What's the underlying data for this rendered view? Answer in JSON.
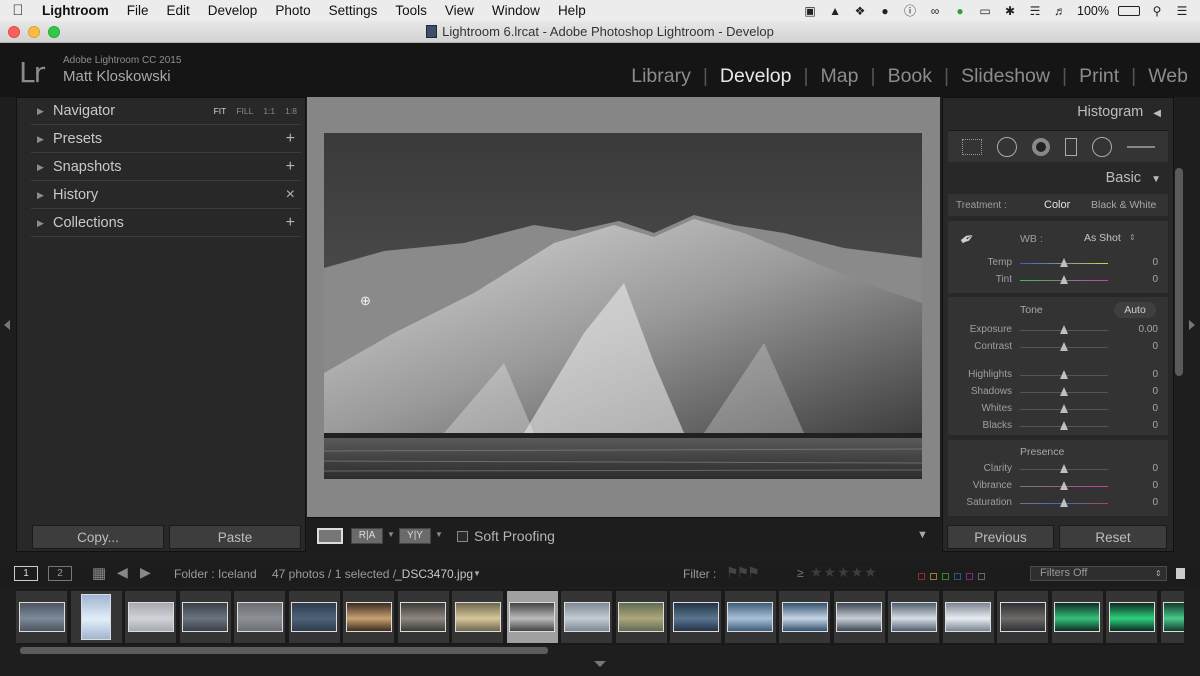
{
  "menubar": {
    "app_name": "Lightroom",
    "items": [
      "File",
      "Edit",
      "Develop",
      "Photo",
      "Settings",
      "Tools",
      "View",
      "Window",
      "Help"
    ],
    "battery": "100%"
  },
  "window": {
    "title": "Lightroom 6.lrcat - Adobe Photoshop Lightroom - Develop"
  },
  "identity_plate": {
    "product": "Adobe Lightroom CC 2015",
    "user": "Matt Kloskowski"
  },
  "modules": {
    "items": [
      "Library",
      "Develop",
      "Map",
      "Book",
      "Slideshow",
      "Print",
      "Web"
    ],
    "active": "Develop"
  },
  "left_panel": {
    "navigator": {
      "label": "Navigator",
      "zoom_options": [
        "FIT",
        "FILL",
        "1:1",
        "1:8"
      ]
    },
    "presets": "Presets",
    "snapshots": "Snapshots",
    "history": "History",
    "collections": "Collections",
    "copy_button": "Copy...",
    "paste_button": "Paste"
  },
  "toolbar": {
    "before_after_1": "R|A",
    "before_after_2": "Y|Y",
    "soft_proofing": "Soft Proofing"
  },
  "right_panel": {
    "histogram": "Histogram",
    "basic": "Basic",
    "treatment_label": "Treatment :",
    "treatment_color": "Color",
    "treatment_bw": "Black & White",
    "wb_label": "WB :",
    "wb_value": "As Shot",
    "tone_label": "Tone",
    "auto_label": "Auto",
    "presence_label": "Presence",
    "sliders": {
      "temp": {
        "label": "Temp",
        "value": "0"
      },
      "tint": {
        "label": "Tint",
        "value": "0"
      },
      "exposure": {
        "label": "Exposure",
        "value": "0.00"
      },
      "contrast": {
        "label": "Contrast",
        "value": "0"
      },
      "highlights": {
        "label": "Highlights",
        "value": "0"
      },
      "shadows": {
        "label": "Shadows",
        "value": "0"
      },
      "whites": {
        "label": "Whites",
        "value": "0"
      },
      "blacks": {
        "label": "Blacks",
        "value": "0"
      },
      "clarity": {
        "label": "Clarity",
        "value": "0"
      },
      "vibrance": {
        "label": "Vibrance",
        "value": "0"
      },
      "saturation": {
        "label": "Saturation",
        "value": "0"
      }
    },
    "previous_button": "Previous",
    "reset_button": "Reset"
  },
  "filmstrip": {
    "monitor_1": "1",
    "monitor_2": "2",
    "folder": "Folder : Iceland",
    "count": "47 photos / 1 selected /",
    "filename": "_DSC3470.jpg",
    "filter_label": "Filter :",
    "filters_value": "Filters Off",
    "selected_index": 9,
    "thumbs": [
      {
        "bg": "#4c5560",
        "accent": "#7d8a99"
      },
      {
        "bg": "#9fb5d1",
        "accent": "#e4eef8"
      },
      {
        "bg": "#a6a9ad",
        "accent": "#d0d3d7"
      },
      {
        "bg": "#3a4047",
        "accent": "#6a7480"
      },
      {
        "bg": "#6b6e72",
        "accent": "#8c9096"
      },
      {
        "bg": "#2e3b4a",
        "accent": "#4f637a"
      },
      {
        "bg": "#3a2d20",
        "accent": "#c9a071"
      },
      {
        "bg": "#3b3a38",
        "accent": "#8f8880"
      },
      {
        "bg": "#6d6650",
        "accent": "#d8c79a"
      },
      {
        "bg": "#444444",
        "accent": "#bcbcbc"
      },
      {
        "bg": "#7c8894",
        "accent": "#c5ccd3"
      },
      {
        "bg": "#5f6c52",
        "accent": "#b0a77c"
      },
      {
        "bg": "#243346",
        "accent": "#5b7590"
      },
      {
        "bg": "#3f5c7a",
        "accent": "#aac2d8"
      },
      {
        "bg": "#33506e",
        "accent": "#c7d6e5"
      },
      {
        "bg": "#3b4754",
        "accent": "#c9cfd6"
      },
      {
        "bg": "#4d5d6e",
        "accent": "#d8dfe6"
      },
      {
        "bg": "#7a8591",
        "accent": "#e9edf1"
      },
      {
        "bg": "#2c3036",
        "accent": "#6e6a66"
      },
      {
        "bg": "#0e2b22",
        "accent": "#36c27a"
      },
      {
        "bg": "#0b2a1f",
        "accent": "#2fd07d"
      },
      {
        "bg": "#123a2a",
        "accent": "#49c98a"
      }
    ]
  },
  "colors": {
    "panel_bg": "#282828",
    "center_bg": "#868686",
    "active_module": "#e8e8e8"
  }
}
